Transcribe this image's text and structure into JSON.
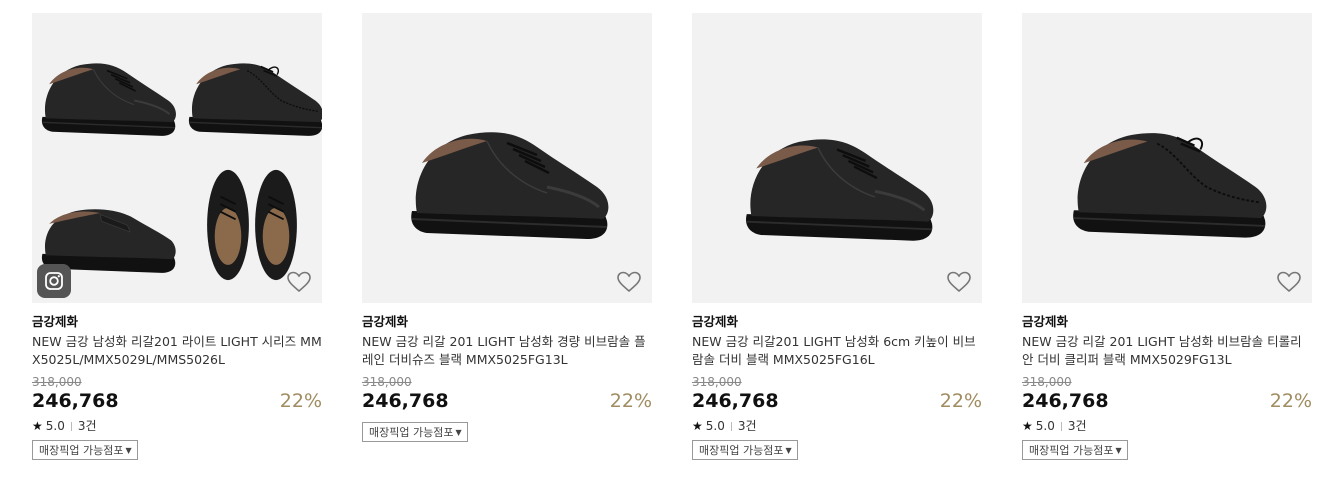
{
  "products": [
    {
      "brand": "금강제화",
      "name": "NEW 금강 남성화 리갈201 라이트 LIGHT 시리즈 MMX5025L/MMX5029L/MMS5026L",
      "original_price": "318,000",
      "price": "246,768",
      "discount": "22%",
      "rating": "5.0",
      "review_count": "3건",
      "pickup_label": "매장픽업 가능점포",
      "image_icon": "shoe-collection-image",
      "badge_icon": "instagram-icon"
    },
    {
      "brand": "금강제화",
      "name": "NEW 금강 리갈 201 LIGHT 남성화 경량 비브람솔 플레인 더비슈즈 블랙 MMX5025FG13L",
      "original_price": "318,000",
      "price": "246,768",
      "discount": "22%",
      "pickup_label": "매장픽업 가능점포",
      "image_icon": "derby-shoe-image"
    },
    {
      "brand": "금강제화",
      "name": "NEW 금강 리갈201 LIGHT 남성화 6cm 키높이 비브람솔 더비 블랙 MMX5025FG16L",
      "original_price": "318,000",
      "price": "246,768",
      "discount": "22%",
      "rating": "5.0",
      "review_count": "3건",
      "pickup_label": "매장픽업 가능점포",
      "image_icon": "derby-shoe-image"
    },
    {
      "brand": "금강제화",
      "name": "NEW 금강 리갈 201 LIGHT 남성화 비브람솔 티롤리안 더비 클리퍼 블랙 MMX5029FG13L",
      "original_price": "318,000",
      "price": "246,768",
      "discount": "22%",
      "rating": "5.0",
      "review_count": "3건",
      "pickup_label": "매장픽업 가능점포",
      "image_icon": "tyrolean-shoe-image"
    }
  ],
  "colors": {
    "thumb_bg": "#f2f2f2",
    "discount": "#a08c60",
    "shoe": "#1e1e1e"
  }
}
